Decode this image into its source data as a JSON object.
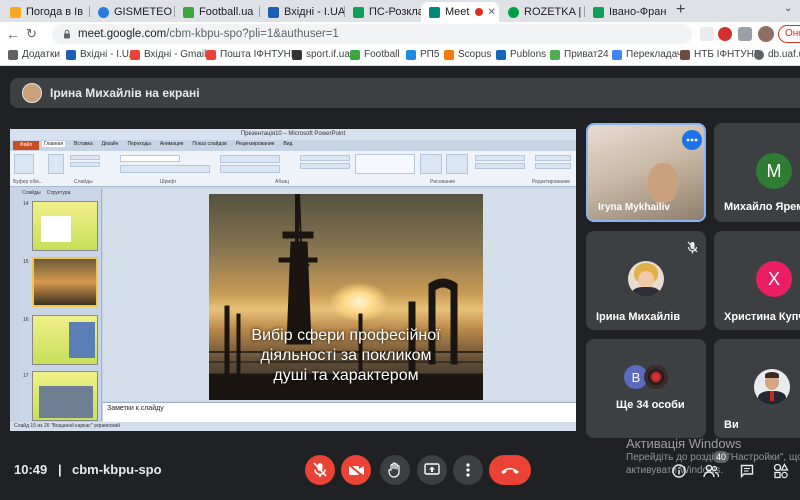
{
  "browser": {
    "tabs": [
      {
        "title": "Погода в Ів",
        "icon": "weather-icon",
        "color": "#f5a623"
      },
      {
        "title": "GISMETEO",
        "icon": "gismeteo-icon",
        "color": "#2a7ae2"
      },
      {
        "title": "Football.ua",
        "icon": "football-icon",
        "color": "#3aa83a"
      },
      {
        "title": "Вхідні - I.UA",
        "icon": "iua-icon",
        "color": "#1a5fb4"
      },
      {
        "title": "ПС-Розклад",
        "icon": "sheets-icon",
        "color": "#0f9d58"
      },
      {
        "title": "Meet",
        "icon": "meet-icon",
        "color": "#00897b"
      },
      {
        "title": "ROZETKA |",
        "icon": "rozetka-icon",
        "color": "#00a046"
      },
      {
        "title": "Івано-Фран",
        "icon": "sheets-icon",
        "color": "#0f9d58"
      }
    ],
    "url_main": "meet.google.com",
    "url_path": "/cbm-kbpu-spo?pli=1&authuser=1",
    "update_label": "Онов",
    "bookmarks": [
      {
        "label": "Додатки",
        "icon": "apps-icon",
        "color": "#5f6368"
      },
      {
        "label": "Вхідні - I.UA",
        "icon": "iua-icon",
        "color": "#1a5fb4"
      },
      {
        "label": "Вхідні - Gmail",
        "icon": "gmail-icon",
        "color": "#ea4335"
      },
      {
        "label": "Пошта ІФНТУНГ",
        "icon": "gmail-icon",
        "color": "#ea4335"
      },
      {
        "label": "sport.if.ua",
        "icon": "sport-icon",
        "color": "#333333"
      },
      {
        "label": "Football",
        "icon": "football-icon",
        "color": "#3aa83a"
      },
      {
        "label": "РП5",
        "icon": "rp5-icon",
        "color": "#1e88e5"
      },
      {
        "label": "Scopus",
        "icon": "scopus-icon",
        "color": "#f57c00"
      },
      {
        "label": "Publons",
        "icon": "publons-icon",
        "color": "#1565c0"
      },
      {
        "label": "Приват24",
        "icon": "privat-icon",
        "color": "#4caf50"
      },
      {
        "label": "Перекладач",
        "icon": "translate-icon",
        "color": "#4285f4"
      },
      {
        "label": "НТБ ІФНТУНГ",
        "icon": "library-icon",
        "color": "#6d4c41"
      },
      {
        "label": "db.uaf.u",
        "icon": "globe-icon",
        "color": "#5f6368"
      }
    ]
  },
  "meet": {
    "presenter": "Ірина Михайлів на екрані",
    "participants": [
      {
        "name": "Ігупа Mykhailiv",
        "type": "video"
      },
      {
        "name": "Михайло Яремч",
        "initial": "M",
        "color": "#2e7d32"
      },
      {
        "name": "Ірина Михайлів",
        "type": "photo"
      },
      {
        "name": "Христина Купча",
        "initial": "X",
        "color": "#e91e63"
      },
      {
        "name": "Ще 34 особи",
        "initial": "B",
        "color": "#5c6bc0"
      },
      {
        "name": "Ви",
        "type": "photo"
      }
    ],
    "time": "10:49",
    "meeting_code": "cbm-kbpu-spo",
    "people_count": "40"
  },
  "ppt": {
    "window_title": "Презентація10 – Microsoft PowerPoint",
    "file_tab": "Файл",
    "ribbon_tabs": [
      "Главная",
      "Вставка",
      "Дизайн",
      "Переходы",
      "Анимация",
      "Показ слайдов",
      "Рецензирование",
      "Вид"
    ],
    "ribbon_groups": [
      "Буфер обм...",
      "Слайды",
      "Шрифт",
      "Абзац",
      "Рисование",
      "Редактирование"
    ],
    "panel_tabs": [
      "Слайды",
      "Структура"
    ],
    "slide_numbers": [
      "14",
      "15",
      "16",
      "17"
    ],
    "slide_title_lines": [
      "Вибір сфери професійної",
      "діяльності за покликом",
      "душі та характером"
    ],
    "notes_placeholder": "Заметки к слайду",
    "status": "Слайд 15 из 26  \"Вощаной каркас\"  украинский"
  },
  "windows_activation": {
    "title": "Активація Windows",
    "line1": "Перейдіть до розділу \"Настройки\", щоб",
    "line2": "активувати Windows."
  }
}
